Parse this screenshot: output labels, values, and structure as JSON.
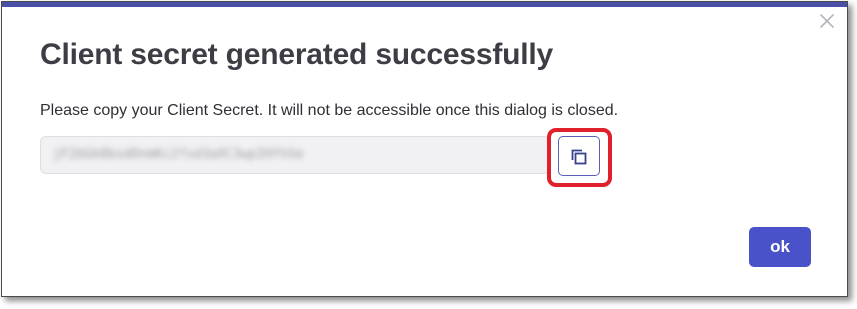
{
  "dialog": {
    "title": "Client secret generated successfully",
    "message": "Please copy your Client Secret. It will not be accessible once this dialog is closed.",
    "secret_value": "jF2bGk0bsdOnmKc2fsd3aXC3wpIHfhSe",
    "secret_state": "blurred",
    "ok_label": "ok",
    "close_icon": "close-icon",
    "copy_icon": "copy-icon"
  },
  "colors": {
    "top_bar": "#4a4fa8",
    "primary_button": "#4a52c9",
    "highlight": "#e0202a",
    "title_text": "#3d3d45"
  }
}
